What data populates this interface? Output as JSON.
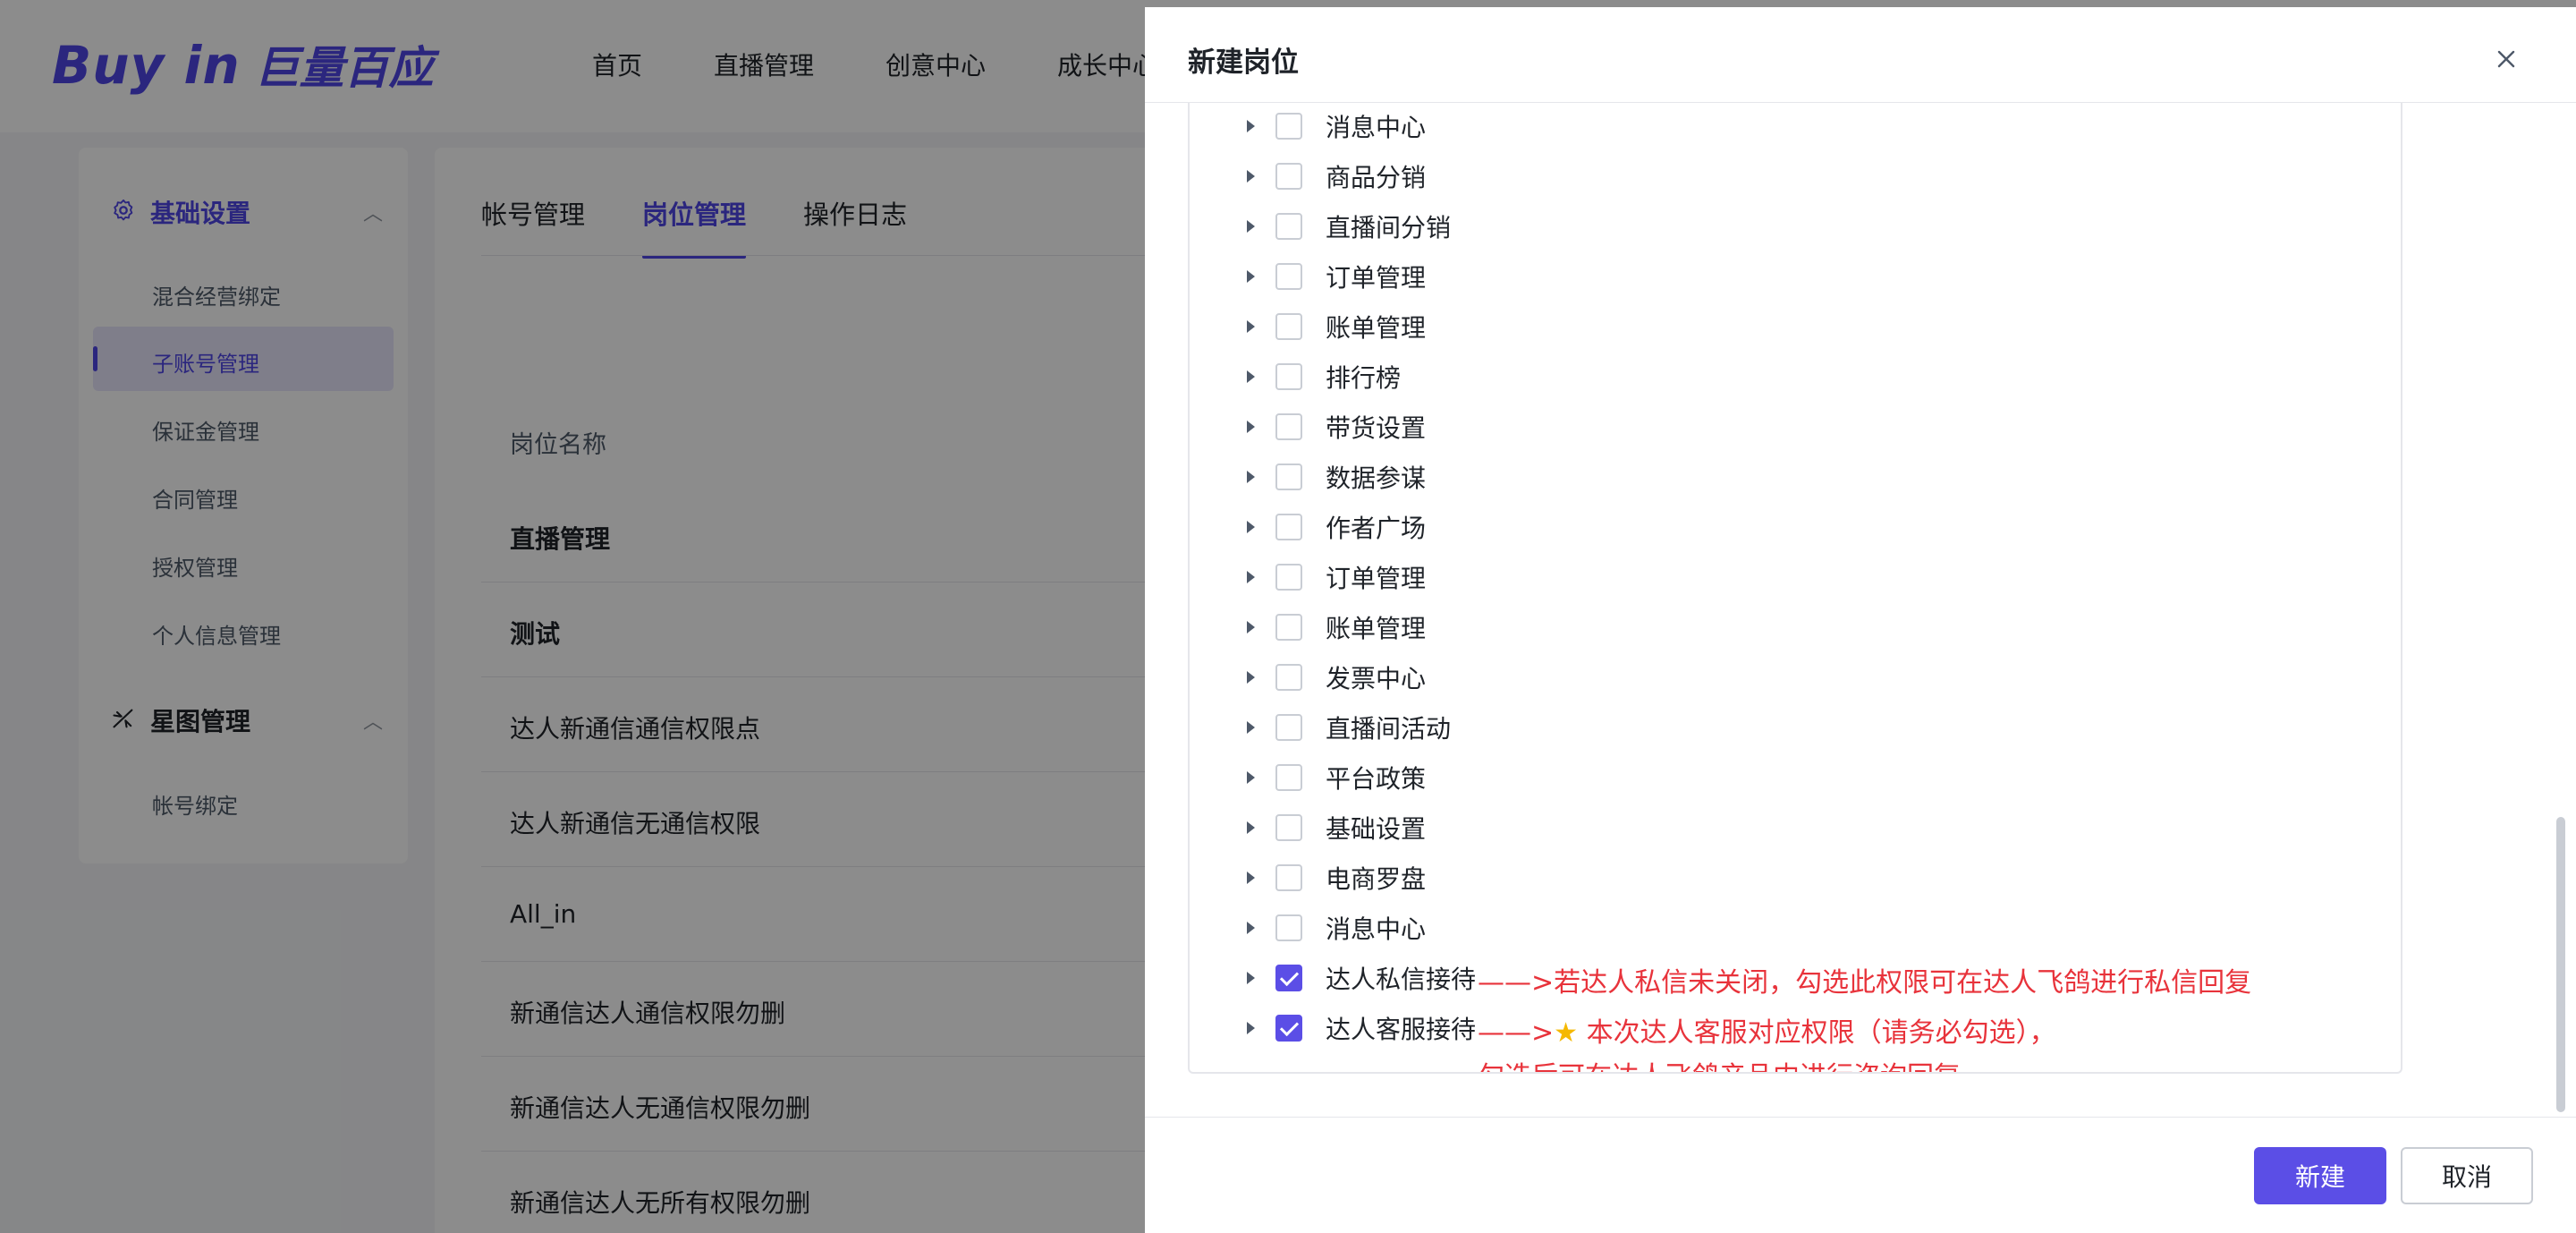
{
  "app": {
    "logo_en": "Buy in",
    "logo_cn": "巨量百应",
    "nav": [
      "首页",
      "直播管理",
      "创意中心",
      "成长中心"
    ]
  },
  "sidebar": {
    "groups": [
      {
        "label": "基础设置",
        "icon": "gear-icon",
        "items": [
          "混合经营绑定",
          "子账号管理",
          "保证金管理",
          "合同管理",
          "授权管理",
          "个人信息管理"
        ],
        "active": "子账号管理"
      },
      {
        "label": "星图管理",
        "icon": "star-map-icon",
        "items": [
          "帐号绑定"
        ]
      }
    ]
  },
  "main": {
    "tabs": [
      {
        "label": "帐号管理",
        "active": false
      },
      {
        "label": "岗位管理",
        "active": true
      },
      {
        "label": "操作日志",
        "active": false
      }
    ],
    "table_header": "岗位名称",
    "rows": [
      "直播管理",
      "测试",
      "达人新通信通信权限点",
      "达人新通信无通信权限",
      "All_in",
      "新通信达人通信权限勿删",
      "新通信达人无通信权限勿删",
      "新通信达人无所有权限勿删"
    ]
  },
  "drawer": {
    "title": "新建岗位",
    "tree": [
      {
        "label": "消息中心",
        "checked": false
      },
      {
        "label": "商品分销",
        "checked": false
      },
      {
        "label": "直播间分销",
        "checked": false
      },
      {
        "label": "订单管理",
        "checked": false
      },
      {
        "label": "账单管理",
        "checked": false
      },
      {
        "label": "排行榜",
        "checked": false
      },
      {
        "label": "带货设置",
        "checked": false
      },
      {
        "label": "数据参谋",
        "checked": false
      },
      {
        "label": "作者广场",
        "checked": false
      },
      {
        "label": "订单管理",
        "checked": false
      },
      {
        "label": "账单管理",
        "checked": false
      },
      {
        "label": "发票中心",
        "checked": false
      },
      {
        "label": "直播间活动",
        "checked": false
      },
      {
        "label": "平台政策",
        "checked": false
      },
      {
        "label": "基础设置",
        "checked": false
      },
      {
        "label": "电商罗盘",
        "checked": false
      },
      {
        "label": "消息中心",
        "checked": false
      },
      {
        "label": "达人私信接待",
        "checked": true
      },
      {
        "label": "达人客服接待",
        "checked": true
      }
    ],
    "annotations": {
      "private_msg": "——>若达人私信未关闭，勾选此权限可在达人飞鸽进行私信回复",
      "service_line1_prefix": "——>",
      "service_line1_text": "本次达人客服对应权限（请务必勾选），",
      "service_line2": "勾选后可在达人飞鸽产品内进行咨询回复"
    },
    "confirm_label": "新建",
    "cancel_label": "取消"
  },
  "colors": {
    "brand": "#5b4ee6",
    "annotation": "#e8333b",
    "star": "#f5b800"
  }
}
